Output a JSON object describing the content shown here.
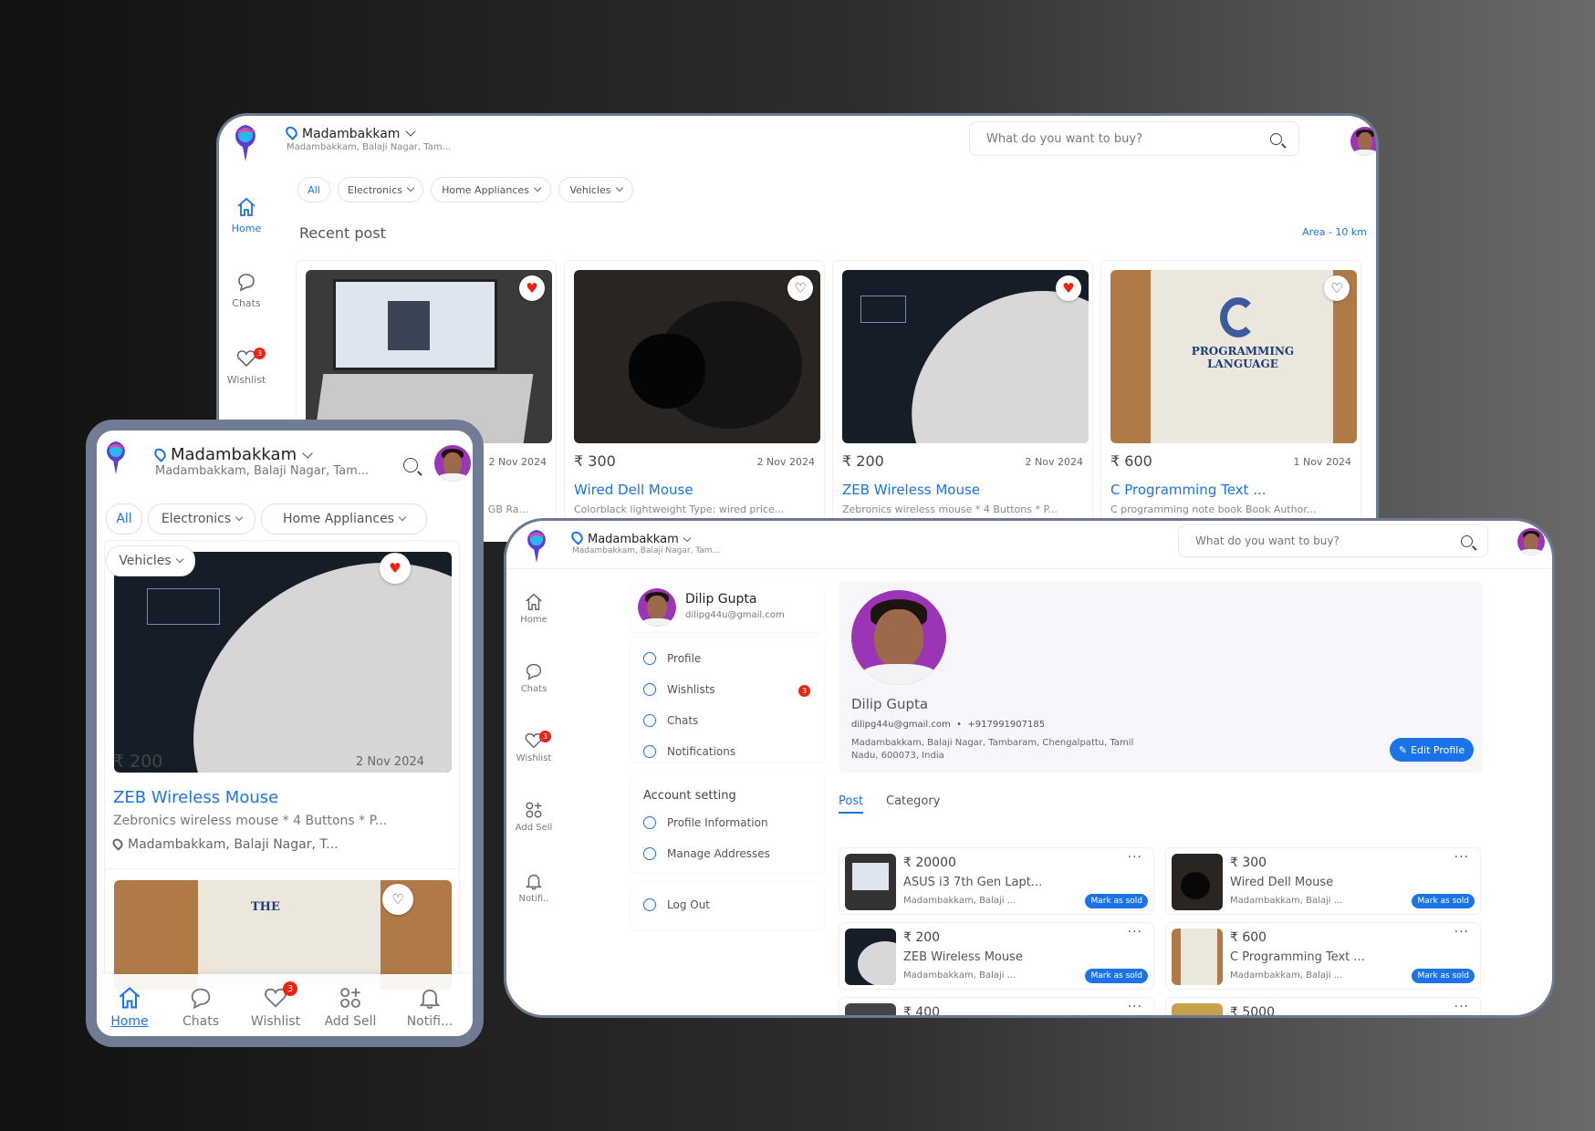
{
  "location": {
    "city": "Madambakkam",
    "address_short": "Madambakkam, Balaji Nagar, Tam...",
    "address_mobile": "Madambakkam, Balaji Nagar, Tam..."
  },
  "search": {
    "placeholder": "What do you want to buy?"
  },
  "filters": [
    "All",
    "Electronics",
    "Home Appliances",
    "Vehicles"
  ],
  "nav": {
    "home": "Home",
    "chats": "Chats",
    "wishlist": "Wishlist",
    "add_sell": "Add Sell",
    "notifications_short": "Notifi..",
    "notifications_mobile": "Notifi...",
    "wishlist_count": "3"
  },
  "desktop": {
    "section_title": "Recent post",
    "area": "Area - 10 km",
    "posts": [
      {
        "price": "₹ 300",
        "date": "2 Nov 2024",
        "title": "Wired Dell Mouse",
        "desc": "Colorblack lightweight Type: wired price...",
        "liked": false
      },
      {
        "price": "₹ 200",
        "date": "2 Nov 2024",
        "title": "ZEB Wireless Mouse",
        "desc": "Zebronics wireless mouse * 4 Buttons * P...",
        "liked": true
      },
      {
        "price": "₹ 600",
        "date": "1 Nov 2024",
        "title": "C Programming Text ...",
        "desc": "C programming note book Book Author...",
        "liked": false
      }
    ],
    "first_post": {
      "date": "2 Nov 2024",
      "desc_tail": "GB Ra...",
      "liked": true
    }
  },
  "mobile": {
    "post": {
      "price": "₹ 200",
      "date": "2 Nov 2024",
      "title": "ZEB Wireless Mouse",
      "desc": "Zebronics wireless mouse * 4 Buttons * P...",
      "location": "Madambakkam, Balaji Nagar, T..."
    }
  },
  "profile": {
    "name": "Dilip Gupta",
    "email": "dilipg44u@gmail.com",
    "phone": "+917991907185",
    "address_line1": "Madambakkam, Balaji Nagar, Tambaram, Chengalpattu, Tamil",
    "address_line2": "Nadu, 600073, India",
    "edit_label": "Edit Profile",
    "menu": {
      "profile": "Profile",
      "wishlists": "Wishlists",
      "chats": "Chats",
      "notifications": "Notifications",
      "wishlist_count": "3"
    },
    "account_setting": "Account setting",
    "account_items": {
      "info": "Profile Information",
      "addresses": "Manage Addresses"
    },
    "logout": "Log Out",
    "tabs": {
      "post": "Post",
      "category": "Category"
    },
    "listings": [
      {
        "price": "₹ 20000",
        "title": "ASUS i3 7th Gen Lapt...",
        "loc": "Madambakkam, Balaji ...",
        "action": "Mark as sold"
      },
      {
        "price": "₹ 300",
        "title": "Wired Dell Mouse",
        "loc": "Madambakkam, Balaji ...",
        "action": "Mark as sold"
      },
      {
        "price": "₹ 200",
        "title": "ZEB Wireless Mouse",
        "loc": "Madambakkam, Balaji ...",
        "action": "Mark as sold"
      },
      {
        "price": "₹ 600",
        "title": "C Programming Text ...",
        "loc": "Madambakkam, Balaji ...",
        "action": "Mark as sold"
      },
      {
        "price": "₹ 400"
      },
      {
        "price": "₹ 5000"
      }
    ]
  },
  "colors": {
    "accent": "#1a73e8",
    "badge": "#ee2211",
    "frame": "#6c7a91",
    "avatar_bg": "#9b35b5"
  }
}
